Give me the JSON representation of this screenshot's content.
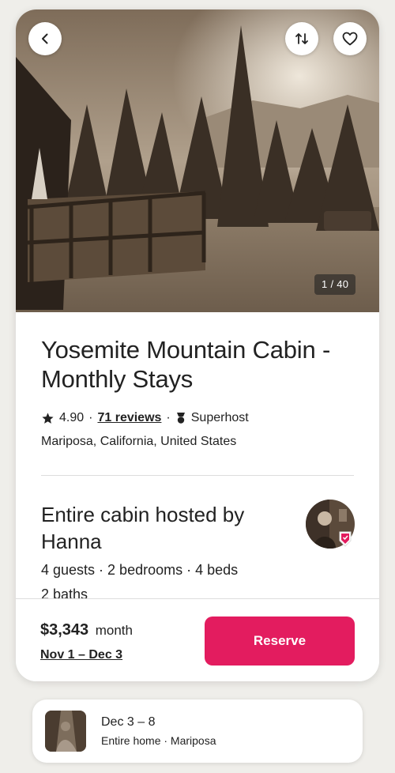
{
  "listing": {
    "title": "Yosemite Mountain Cabin - Monthly Stays",
    "rating": "4.90",
    "reviews_link": "71 reviews",
    "host_status": "Superhost",
    "location": "Mariposa, California, United States",
    "photo_counter": "1 / 40"
  },
  "host": {
    "heading": "Entire cabin hosted by Hanna",
    "specs": "4 guests · 2 bedrooms · 4 beds",
    "baths": "2 baths"
  },
  "booking": {
    "price": "$3,343",
    "price_unit": "month",
    "dates": "Nov 1 – Dec 3",
    "reserve_label": "Reserve",
    "accent_color": "#e31c5f"
  },
  "upcoming_trip": {
    "dates": "Dec 3 – 8",
    "subtitle": "Entire home · Mariposa"
  },
  "icons": {
    "back": "chevron-left-icon",
    "share": "share-arrows-icon",
    "save": "heart-icon",
    "rating": "star-icon",
    "superhost": "medal-icon"
  }
}
